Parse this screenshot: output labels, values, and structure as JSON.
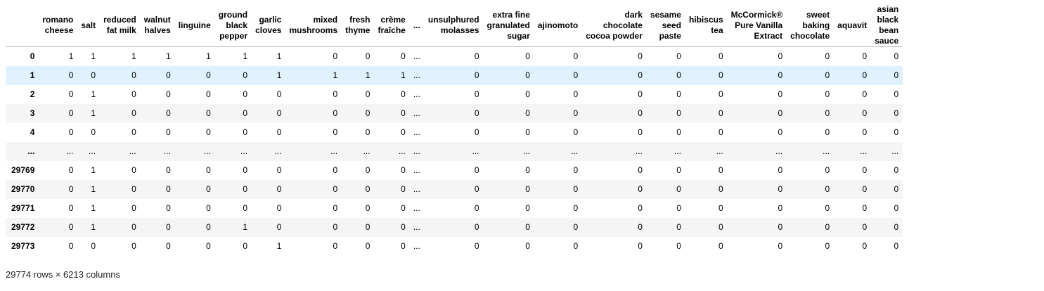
{
  "columns": [
    "",
    "romano\ncheese",
    "salt",
    "reduced\nfat milk",
    "walnut\nhalves",
    "linguine",
    "ground\nblack\npepper",
    "garlic\ncloves",
    "mixed\nmushrooms",
    "fresh\nthyme",
    "crème\nfraîche",
    "...",
    "unsulphured\nmolasses",
    "extra fine\ngranulated\nsugar",
    "ajinomoto",
    "dark\nchocolate\ncocoa powder",
    "sesame\nseed\npaste",
    "hibiscus\ntea",
    "McCormick®\nPure Vanilla\nExtract",
    "sweet\nbaking\nchocolate",
    "aquavit",
    "asian\nblack\nbean\nsauce"
  ],
  "rows": [
    {
      "index": "0",
      "values": [
        "1",
        "1",
        "1",
        "1",
        "1",
        "1",
        "1",
        "0",
        "0",
        "0",
        "...",
        "0",
        "0",
        "0",
        "0",
        "0",
        "0",
        "0",
        "0",
        "0",
        "0"
      ]
    },
    {
      "index": "1",
      "values": [
        "0",
        "0",
        "0",
        "0",
        "0",
        "0",
        "1",
        "1",
        "1",
        "1",
        "...",
        "0",
        "0",
        "0",
        "0",
        "0",
        "0",
        "0",
        "0",
        "0",
        "0"
      ]
    },
    {
      "index": "2",
      "values": [
        "0",
        "1",
        "0",
        "0",
        "0",
        "0",
        "0",
        "0",
        "0",
        "0",
        "...",
        "0",
        "0",
        "0",
        "0",
        "0",
        "0",
        "0",
        "0",
        "0",
        "0"
      ]
    },
    {
      "index": "3",
      "values": [
        "0",
        "1",
        "0",
        "0",
        "0",
        "0",
        "0",
        "0",
        "0",
        "0",
        "...",
        "0",
        "0",
        "0",
        "0",
        "0",
        "0",
        "0",
        "0",
        "0",
        "0"
      ]
    },
    {
      "index": "4",
      "values": [
        "0",
        "0",
        "0",
        "0",
        "0",
        "0",
        "0",
        "0",
        "0",
        "0",
        "...",
        "0",
        "0",
        "0",
        "0",
        "0",
        "0",
        "0",
        "0",
        "0",
        "0"
      ]
    },
    {
      "index": "...",
      "values": [
        "...",
        "...",
        "...",
        "...",
        "...",
        "...",
        "...",
        "...",
        "...",
        "...",
        "...",
        "...",
        "...",
        "...",
        "...",
        "...",
        "...",
        "...",
        "...",
        "...",
        "..."
      ]
    },
    {
      "index": "29769",
      "values": [
        "0",
        "1",
        "0",
        "0",
        "0",
        "0",
        "0",
        "0",
        "0",
        "0",
        "...",
        "0",
        "0",
        "0",
        "0",
        "0",
        "0",
        "0",
        "0",
        "0",
        "0"
      ]
    },
    {
      "index": "29770",
      "values": [
        "0",
        "1",
        "0",
        "0",
        "0",
        "0",
        "0",
        "0",
        "0",
        "0",
        "...",
        "0",
        "0",
        "0",
        "0",
        "0",
        "0",
        "0",
        "0",
        "0",
        "0"
      ]
    },
    {
      "index": "29771",
      "values": [
        "0",
        "1",
        "0",
        "0",
        "0",
        "0",
        "0",
        "0",
        "0",
        "0",
        "...",
        "0",
        "0",
        "0",
        "0",
        "0",
        "0",
        "0",
        "0",
        "0",
        "0"
      ]
    },
    {
      "index": "29772",
      "values": [
        "0",
        "1",
        "0",
        "0",
        "0",
        "1",
        "0",
        "0",
        "0",
        "0",
        "...",
        "0",
        "0",
        "0",
        "0",
        "0",
        "0",
        "0",
        "0",
        "0",
        "0"
      ]
    },
    {
      "index": "29773",
      "values": [
        "0",
        "0",
        "0",
        "0",
        "0",
        "0",
        "1",
        "0",
        "0",
        "0",
        "...",
        "0",
        "0",
        "0",
        "0",
        "0",
        "0",
        "0",
        "0",
        "0",
        "0"
      ]
    }
  ],
  "highlighted_row": "1",
  "footer": "29774 rows × 6213 columns"
}
